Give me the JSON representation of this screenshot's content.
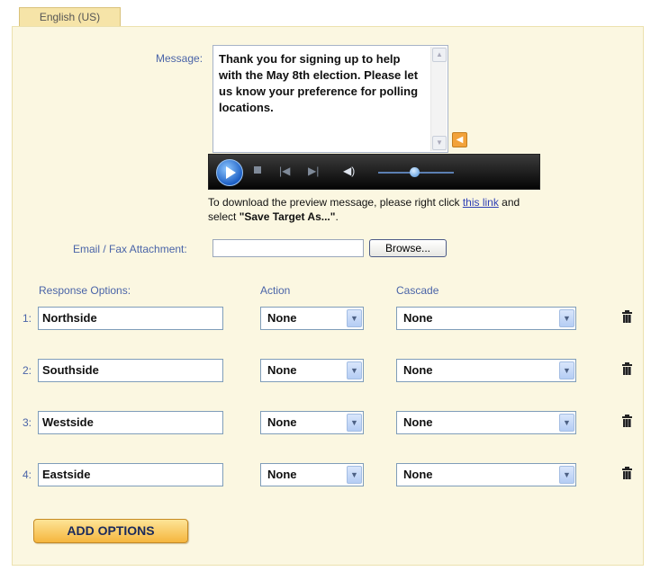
{
  "tab": {
    "label": "English (US)"
  },
  "message": {
    "label": "Message:",
    "text": "Thank you for signing up to help with the May 8th election. Please let us know your preference for polling locations."
  },
  "download": {
    "prefix": "To download the preview message, please right click ",
    "link_text": "this link",
    "middle": " and select ",
    "bold_text": "\"Save Target As...\"",
    "suffix": "."
  },
  "email": {
    "label": "Email / Fax Attachment:",
    "value": "",
    "browse_label": "Browse..."
  },
  "headers": {
    "response": "Response Options:",
    "action": "Action",
    "cascade": "Cascade"
  },
  "rows": [
    {
      "num": "1:",
      "response": "Northside",
      "action": "None",
      "cascade": "None"
    },
    {
      "num": "2:",
      "response": "Southside",
      "action": "None",
      "cascade": "None"
    },
    {
      "num": "3:",
      "response": "Westside",
      "action": "None",
      "cascade": "None"
    },
    {
      "num": "4:",
      "response": "Eastside",
      "action": "None",
      "cascade": "None"
    }
  ],
  "add_button": "ADD OPTIONS",
  "icons": {
    "speaker": "speaker-icon",
    "play": "play-icon",
    "stop": "stop-icon",
    "prev": "previous-icon",
    "next": "next-icon",
    "volume": "volume-icon",
    "trash": "trash-icon",
    "dropdown": "chevron-down-icon"
  },
  "colors": {
    "panel": "#fbf7e1",
    "tab": "#f6e4a8",
    "label": "#4a64a8",
    "button": "#f5b63e",
    "link": "#2e3fb5"
  }
}
